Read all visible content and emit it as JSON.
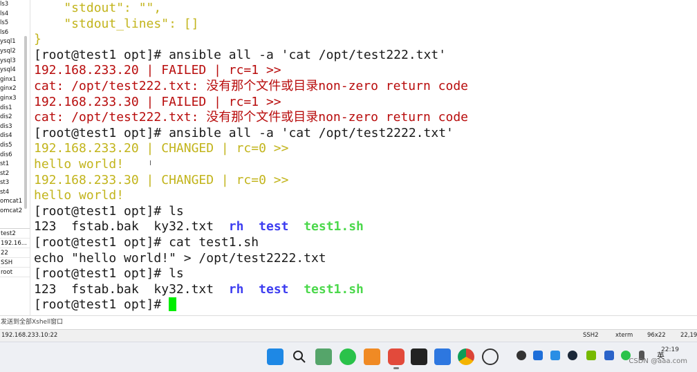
{
  "sidebar": {
    "sessions": [
      "ls3",
      "ls4",
      "ls5",
      "ls6",
      "ysql1",
      "ysql2",
      "ysql3",
      "ysql4",
      "ginx1",
      "ginx2",
      "ginx3",
      "dis1",
      "dis2",
      "dis3",
      "dis4",
      "dis5",
      "dis6",
      "st1",
      "st2",
      "st3",
      "st4",
      "omcat1",
      "omcat2"
    ],
    "properties": [
      "test2",
      "192.16...",
      "22",
      "SSH",
      "root"
    ]
  },
  "terminal": {
    "lines": [
      {
        "segs": [
          {
            "t": "    \"stdout\": \"\",",
            "c": "yellow"
          }
        ]
      },
      {
        "segs": [
          {
            "t": "    \"stdout_lines\": []",
            "c": "yellow"
          }
        ]
      },
      {
        "segs": [
          {
            "t": "}",
            "c": "yellow"
          }
        ]
      },
      {
        "segs": [
          {
            "t": "[root@test1 opt]# ansible all -a 'cat /opt/test222.txt'",
            "c": "default"
          }
        ]
      },
      {
        "segs": [
          {
            "t": "192.168.233.20 | FAILED | rc=1 >>",
            "c": "red"
          }
        ]
      },
      {
        "segs": [
          {
            "t": "cat: /opt/test222.txt: 没有那个文件或目录non-zero return code",
            "c": "red"
          }
        ]
      },
      {
        "segs": [
          {
            "t": "192.168.233.30 | FAILED | rc=1 >>",
            "c": "red"
          }
        ]
      },
      {
        "segs": [
          {
            "t": "cat: /opt/test222.txt: 没有那个文件或目录non-zero return code",
            "c": "red"
          }
        ]
      },
      {
        "segs": [
          {
            "t": "[root@test1 opt]# ansible all -a 'cat /opt/test2222.txt'",
            "c": "default"
          }
        ]
      },
      {
        "segs": [
          {
            "t": "192.168.233.20 | CHANGED | rc=0 >>",
            "c": "yellow"
          }
        ]
      },
      {
        "segs": [
          {
            "t": "hello world!",
            "c": "yellow"
          }
        ]
      },
      {
        "segs": [
          {
            "t": "192.168.233.30 | CHANGED | rc=0 >>",
            "c": "yellow"
          }
        ]
      },
      {
        "segs": [
          {
            "t": "hello world!",
            "c": "yellow"
          }
        ]
      },
      {
        "segs": [
          {
            "t": "[root@test1 opt]# ls",
            "c": "default"
          }
        ]
      },
      {
        "segs": [
          {
            "t": "123  fstab.bak  ky32.txt  ",
            "c": "default"
          },
          {
            "t": "rh",
            "c": "blue"
          },
          {
            "t": "  ",
            "c": "default"
          },
          {
            "t": "test",
            "c": "blue"
          },
          {
            "t": "  ",
            "c": "default"
          },
          {
            "t": "test1.sh",
            "c": "green"
          }
        ]
      },
      {
        "segs": [
          {
            "t": "[root@test1 opt]# cat test1.sh",
            "c": "default"
          }
        ]
      },
      {
        "segs": [
          {
            "t": "echo \"hello world!\" > /opt/test2222.txt",
            "c": "default"
          }
        ]
      },
      {
        "segs": [
          {
            "t": "[root@test1 opt]# ls",
            "c": "default"
          }
        ]
      },
      {
        "segs": [
          {
            "t": "123  fstab.bak  ky32.txt  ",
            "c": "default"
          },
          {
            "t": "rh",
            "c": "blue"
          },
          {
            "t": "  ",
            "c": "default"
          },
          {
            "t": "test",
            "c": "blue"
          },
          {
            "t": "  ",
            "c": "default"
          },
          {
            "t": "test1.sh",
            "c": "green"
          }
        ]
      },
      {
        "segs": [
          {
            "t": "[root@test1 opt]# ",
            "c": "default"
          }
        ],
        "cursor": true
      }
    ]
  },
  "compose": {
    "placeholder": "发送到全部Xshell窗口"
  },
  "statusbar": {
    "connection": "192.168.233.10:22",
    "protocol": "SSH2",
    "term": "xterm",
    "size": "96x22",
    "position": "22,19"
  },
  "taskbar": {
    "apps": [
      "windows-start-icon",
      "search-icon",
      "photo-app-icon",
      "wechat-icon",
      "sticky-app-icon",
      "xshell-icon",
      "typora-icon",
      "whiteboard-icon",
      "chrome-icon",
      "openai-icon"
    ],
    "tray_icons": [
      "settings-tray-icon",
      "tray-app-icon",
      "tray-app-icon-2",
      "steam-tray-icon",
      "nvidia-tray-icon",
      "bluetooth-tray-icon",
      "wechat-tray-icon",
      "speaker-tray-icon"
    ],
    "ime": "英",
    "clock": "22:19",
    "watermark": "CSDN @aaa.com"
  }
}
